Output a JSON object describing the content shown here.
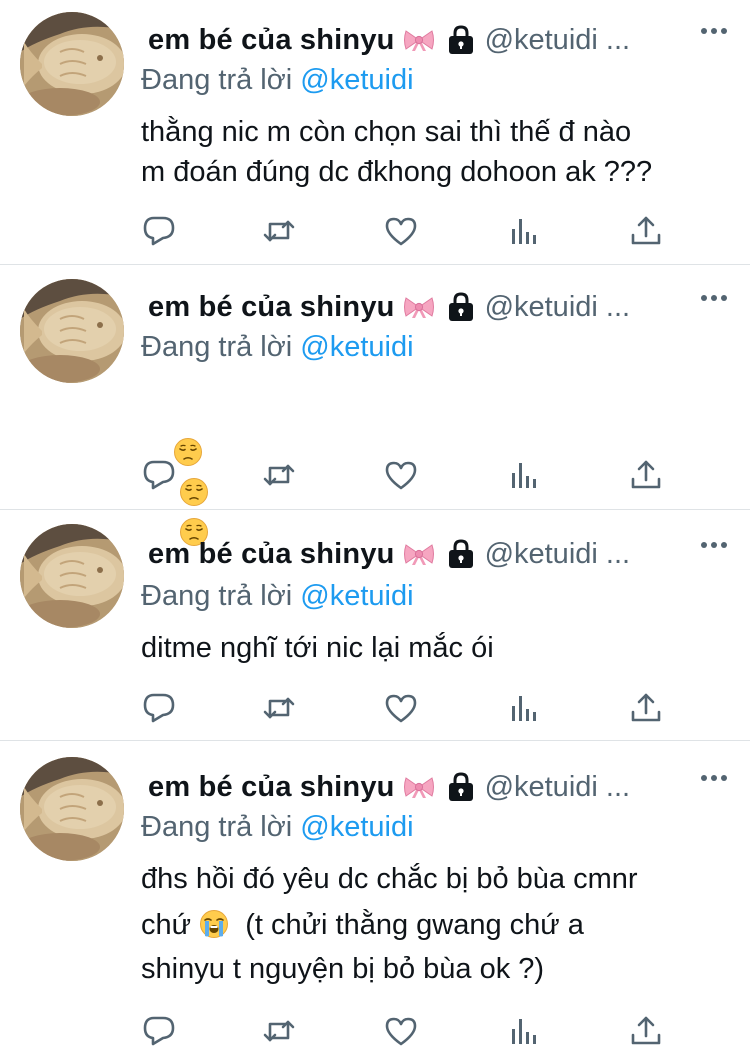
{
  "tweets": [
    {
      "author_name": "em bé của shinyu",
      "author_handle": "@ketuidi ...",
      "reply_prefix": "Đang trả lời ",
      "reply_mention": "@ketuidi",
      "text": "thằng nic m còn chọn sai thì thế đ nào\nm đoán đúng dc đkhong dohoon ak ???",
      "text_emojis": []
    },
    {
      "author_name": "em bé của shinyu",
      "author_handle": "@ketuidi ...",
      "reply_prefix": "Đang trả lời ",
      "reply_mention": "@ketuidi",
      "text": "",
      "text_emojis": [
        "pensive-face",
        "pensive-face",
        "pensive-face"
      ]
    },
    {
      "author_name": "em bé của shinyu",
      "author_handle": "@ketuidi ...",
      "reply_prefix": "Đang trả lời ",
      "reply_mention": "@ketuidi",
      "text": "ditme nghĩ tới nic lại mắc ói",
      "text_emojis": []
    },
    {
      "author_name": "em bé của shinyu",
      "author_handle": "@ketuidi ...",
      "reply_prefix": "Đang trả lời ",
      "reply_mention": "@ketuidi",
      "text_line1": "đhs hồi đó yêu dc chắc bị bỏ bùa cmnr",
      "text_line2_before": "chứ ",
      "text_line2_emoji": "loudly-crying-face",
      "text_line2_after": "  (t chửi thằng gwang chứ a",
      "text_line3": "shinyu t nguyện bị bỏ bùa ok ?)"
    }
  ],
  "icons": {
    "name_badge": "ribbon-bow-icon",
    "protected": "lock-icon",
    "more": "more-dots-icon",
    "actions": [
      "reply-icon",
      "retweet-icon",
      "like-icon",
      "views-icon",
      "share-icon"
    ]
  },
  "colors": {
    "text_primary": "#0f1419",
    "text_secondary": "#536471",
    "accent": "#1d9bf0",
    "divider": "#dfe3e6",
    "icon": "#536471"
  }
}
